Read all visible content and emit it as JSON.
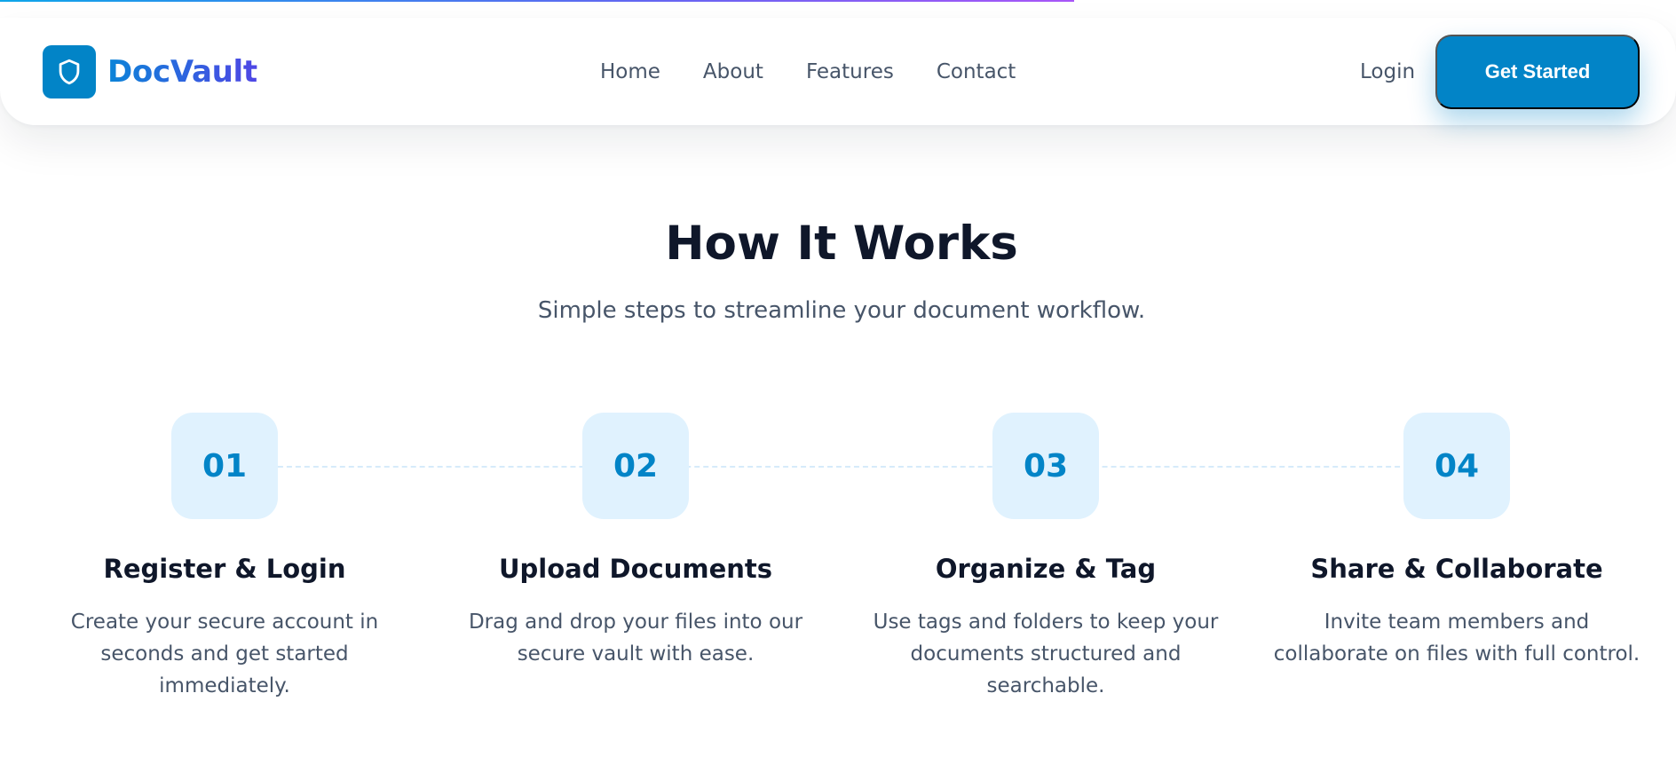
{
  "brand": {
    "name": "DocVault",
    "icon": "shield-icon",
    "color": "#0284c7"
  },
  "nav": {
    "links": [
      "Home",
      "About",
      "Features",
      "Contact"
    ],
    "login_label": "Login",
    "cta_label": "Get Started"
  },
  "section": {
    "title": "How It Works",
    "subtitle": "Simple steps to streamline your document workflow."
  },
  "steps": [
    {
      "number": "01",
      "title": "Register & Login",
      "description": "Create your secure account in seconds and get started immediately."
    },
    {
      "number": "02",
      "title": "Upload Documents",
      "description": "Drag and drop your files into our secure vault with ease."
    },
    {
      "number": "03",
      "title": "Organize & Tag",
      "description": "Use tags and folders to keep your documents structured and searchable."
    },
    {
      "number": "04",
      "title": "Share & Collaborate",
      "description": "Invite team members and collaborate on files with full control."
    }
  ],
  "colors": {
    "accent": "#0284c7",
    "step_bg": "#e0f2fe",
    "heading": "#0f172a",
    "body_text": "#475569"
  }
}
